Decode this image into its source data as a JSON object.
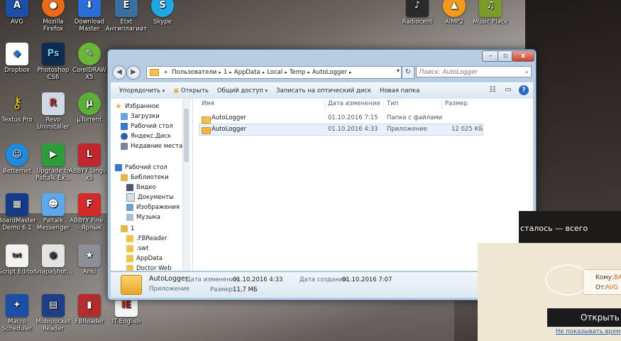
{
  "desktop_icons": {
    "avg": "AVG",
    "firefox": "Mozilla Firefox",
    "download_master": "Download Master",
    "etxt": "Etxt Антиплагиат",
    "skype": "Skype",
    "radiocent": "Radiocent",
    "aimp": "AIMP2",
    "music_place": "Music Place",
    "dropbox": "Dropbox",
    "photoshop": "Photoshop CS6",
    "coreldraw": "CorelDRAW X5",
    "textus": "Textus Pro",
    "revo": "Revo Uninstaller",
    "utorrent": "µTorrent",
    "betternet": "Betternet",
    "paltalk_upgrade": "Upgrade to Paltalk Ex...",
    "abbyy_lingvo": "ABBYY Lingvo x5",
    "boardmaster": "BoardMaster Demo 6.1",
    "paltalk": "Paltalk Messenger",
    "abbyy_fine": "ABBYY Fine... - Ярлык",
    "script_editor": "Script Editor",
    "snapshot": "SnapaShot...",
    "anki": "Anki",
    "macro": "Macro Scheduler",
    "mobipocket": "Mobipocket Reader",
    "fbreader": "FBReader",
    "it_english": "IT-English"
  },
  "window": {
    "controls": {
      "minimize": "–",
      "maximize": "▫",
      "close": "x"
    },
    "address": {
      "crumbs": [
        "Пользователи",
        "1",
        "AppData",
        "Local",
        "Temp",
        "AutoLogger"
      ],
      "prefix": "«",
      "search_placeholder": "Поиск: AutoLogger"
    },
    "toolbar": {
      "organize": "Упорядочить",
      "open": "Открыть",
      "share": "Общий доступ",
      "burn": "Записать на оптический диск",
      "new_folder": "Новая папка"
    },
    "nav": {
      "favorites": "Избранное",
      "downloads": "Загрузки",
      "desktop": "Рабочий стол",
      "yandex": "Яндекс.Диск",
      "recent": "Недавние места",
      "desktop2": "Рабочий стол",
      "libraries": "Библиотеки",
      "video": "Видео",
      "documents": "Документы",
      "images": "Изображения",
      "music": "Музыка",
      "user": "1",
      "fbreader": ".FBReader",
      "swt": ".swt",
      "appdata": "AppData",
      "doctorweb": "Doctor Web"
    },
    "columns": {
      "name": "Имя",
      "date": "Дата изменения",
      "type": "Тип",
      "size": "Размер"
    },
    "files": [
      {
        "name": "AutoLogger",
        "date": "01.10.2016 7:15",
        "type": "Папка с файлами",
        "size": ""
      },
      {
        "name": "AutoLogger",
        "date": "01.10.2016 4:33",
        "type": "Приложение",
        "size": "12 025 КБ"
      }
    ],
    "details": {
      "name": "AutoLogger",
      "kind": "Приложение",
      "modified_label": "Дата изменения:",
      "modified_value": "01.10.2016 4:33",
      "size_label": "Размер:",
      "size_value": "11,7 МБ",
      "created_label": "Дата создания:",
      "created_value": "01.10.2016 7:07"
    }
  },
  "notification": {
    "headline": "сталось — всего",
    "to_label": "Кому:",
    "to_value": "BA",
    "from_label": "От:",
    "from_value": "AVG",
    "open_button": "Открыть",
    "dont_show": "Не показывать врем"
  },
  "colors": {
    "folder": "#f0c24e",
    "selection": "#e8f0fb",
    "window_frame": "#b8cde2",
    "link": "#2a5fb0"
  }
}
